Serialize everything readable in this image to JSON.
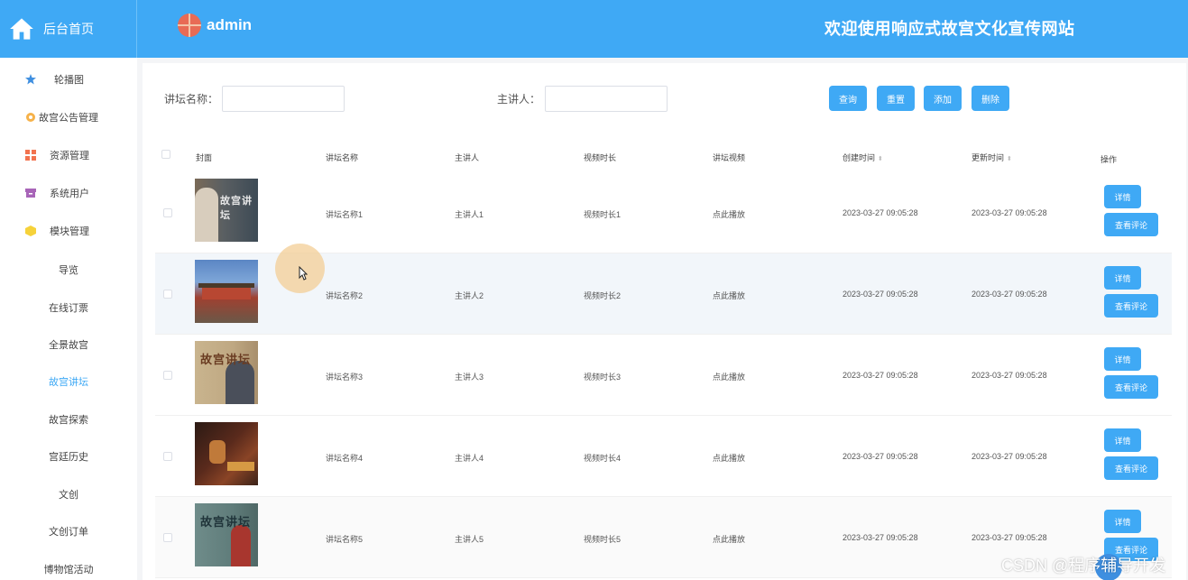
{
  "header": {
    "home_label": "后台首页",
    "username": "admin",
    "site_title": "欢迎使用响应式故宫文化宣传网站"
  },
  "sidebar": {
    "items": [
      {
        "label": "轮播图"
      },
      {
        "label": "故宫公告管理"
      },
      {
        "label": "资源管理"
      },
      {
        "label": "系统用户"
      },
      {
        "label": "模块管理"
      },
      {
        "label": "导览"
      },
      {
        "label": "在线订票"
      },
      {
        "label": "全景故宫"
      },
      {
        "label": "故宫讲坛"
      },
      {
        "label": "故宫探索"
      },
      {
        "label": "宫廷历史"
      },
      {
        "label": "文创"
      },
      {
        "label": "文创订单"
      },
      {
        "label": "博物馆活动"
      }
    ]
  },
  "search": {
    "name_label": "讲坛名称：",
    "speaker_label": "主讲人：",
    "name_value": "",
    "speaker_value": "",
    "query": "查询",
    "reset": "重置",
    "add": "添加",
    "delete": "删除"
  },
  "table": {
    "headers": [
      "封面",
      "讲坛名称",
      "主讲人",
      "视频时长",
      "讲坛视频",
      "创建时间",
      "更新时间",
      "操作"
    ],
    "detail_label": "详情",
    "comments_label": "查看评论",
    "rows": [
      {
        "name": "讲坛名称1",
        "speaker": "主讲人1",
        "duration": "视频时长1",
        "video": "点此播放",
        "created": "2023-03-27 09:05:28",
        "updated": "2023-03-27 09:05:28",
        "thumb_text": "故宫讲坛"
      },
      {
        "name": "讲坛名称2",
        "speaker": "主讲人2",
        "duration": "视频时长2",
        "video": "点此播放",
        "created": "2023-03-27 09:05:28",
        "updated": "2023-03-27 09:05:28",
        "thumb_text": ""
      },
      {
        "name": "讲坛名称3",
        "speaker": "主讲人3",
        "duration": "视频时长3",
        "video": "点此播放",
        "created": "2023-03-27 09:05:28",
        "updated": "2023-03-27 09:05:28",
        "thumb_text": "故宫讲坛"
      },
      {
        "name": "讲坛名称4",
        "speaker": "主讲人4",
        "duration": "视频时长4",
        "video": "点此播放",
        "created": "2023-03-27 09:05:28",
        "updated": "2023-03-27 09:05:28",
        "thumb_text": ""
      },
      {
        "name": "讲坛名称5",
        "speaker": "主讲人5",
        "duration": "视频时长5",
        "video": "点此播放",
        "created": "2023-03-27 09:05:28",
        "updated": "2023-03-27 09:05:28",
        "thumb_text": "故宫讲坛"
      }
    ]
  },
  "watermark": "CSDN @程序辅导开发",
  "colors": {
    "primary": "#3fa9f5",
    "active_nav": "#3fa9f5"
  }
}
